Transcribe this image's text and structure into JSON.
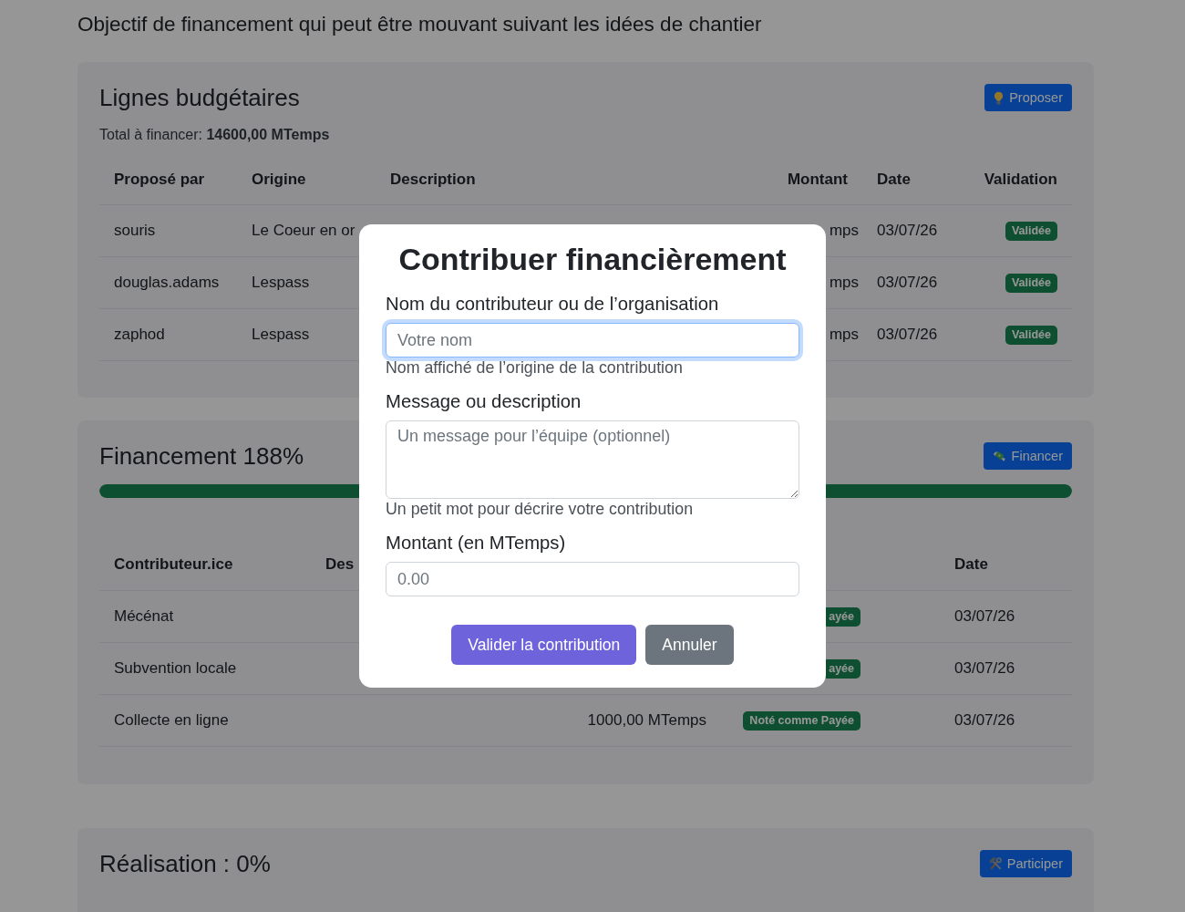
{
  "page": {
    "heading": "Objectif de financement qui peut être mouvant suivant les idées de chantier"
  },
  "budget": {
    "title": "Lignes budgétaires",
    "total": "Total à financer: **14600,00 MTemps**",
    "button": "Proposer",
    "columns": [
      "Proposé par",
      "Origine",
      "Description",
      "Montant",
      "Date",
      "Validation"
    ],
    "rows": [
      {
        "proposed_by": "souris",
        "origin": "Le Coeur en or",
        "amount": "mps",
        "date": "03/07/26",
        "validation": "Validée"
      },
      {
        "proposed_by": "douglas.adams",
        "origin": "Lespass",
        "amount": "mps",
        "date": "03/07/26",
        "validation": "Validée"
      },
      {
        "proposed_by": "zaphod",
        "origin": "Lespass",
        "amount": "mps",
        "date": "03/07/26",
        "validation": "Validée"
      }
    ]
  },
  "funding": {
    "title": "Financement 188%",
    "button": "Financer",
    "progress": {
      "level": 1
    },
    "columns": {
      "contributor": "Contributeur.ice",
      "description": "Des",
      "date": "Date"
    },
    "rows": [
      {
        "contributor": "Mécénat",
        "status": "ayée",
        "date": "03/07/26"
      },
      {
        "contributor": "Subvention locale",
        "status": "ayée",
        "date": "03/07/26"
      },
      {
        "contributor": "Collecte en ligne",
        "amount": "1000,00 MTemps",
        "status": "Noté comme Payée",
        "date": "03/07/26"
      }
    ]
  },
  "realisation": {
    "title": "Réalisation : 0%",
    "button": "Participer"
  },
  "modal": {
    "title": "Contribuer financièrement",
    "fields": [
      {
        "kind": "input",
        "label": "Nom du contributeur ou de l’organisation",
        "placeholder": "Votre nom",
        "help": "Nom affiché de l’origine de la contribution",
        "focused": true
      },
      {
        "kind": "textarea",
        "label": "Message ou description",
        "placeholder": "Un message pour l’équipe (optionnel)",
        "help": "Un petit mot pour décrire votre contribution",
        "focused": false
      },
      {
        "kind": "input",
        "label": "Montant (en MTemps)",
        "placeholder": "0.00",
        "focused": false
      }
    ],
    "buttons": [
      {
        "kind": "primary",
        "label": "Valider la contribution"
      },
      {
        "kind": "secondary",
        "label": "Annuler"
      }
    ]
  }
}
